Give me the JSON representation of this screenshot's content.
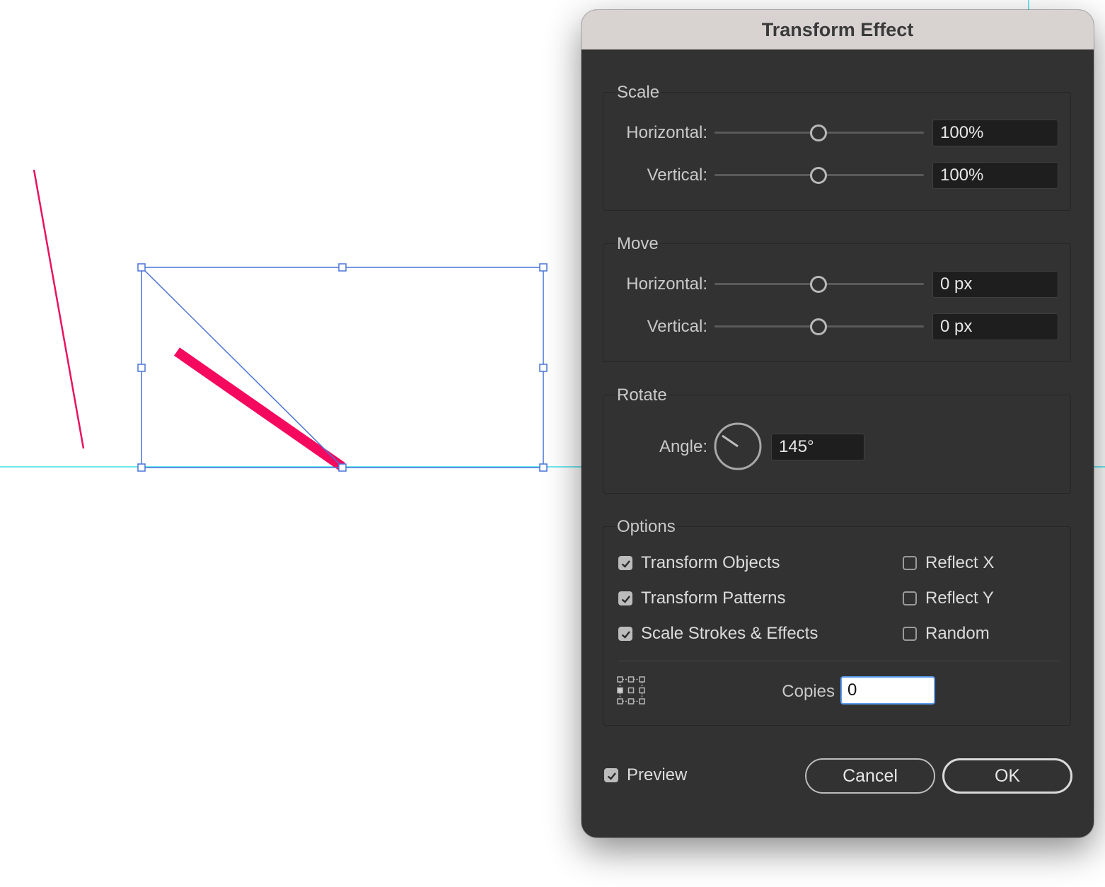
{
  "dialog": {
    "title": "Transform Effect",
    "scale": {
      "title": "Scale",
      "horizontal_label": "Horizontal:",
      "horizontal_value": "100%",
      "vertical_label": "Vertical:",
      "vertical_value": "100%"
    },
    "move": {
      "title": "Move",
      "horizontal_label": "Horizontal:",
      "horizontal_value": "0 px",
      "vertical_label": "Vertical:",
      "vertical_value": "0 px"
    },
    "rotate": {
      "title": "Rotate",
      "angle_label": "Angle:",
      "angle_value": "145°"
    },
    "options": {
      "title": "Options",
      "transform_objects": {
        "label": "Transform Objects",
        "checked": true
      },
      "transform_patterns": {
        "label": "Transform Patterns",
        "checked": true
      },
      "scale_strokes": {
        "label": "Scale Strokes & Effects",
        "checked": true
      },
      "reflect_x": {
        "label": "Reflect X",
        "checked": false
      },
      "reflect_y": {
        "label": "Reflect Y",
        "checked": false
      },
      "random": {
        "label": "Random",
        "checked": false
      },
      "reference_point_icon": "reference-point-grid-icon",
      "copies_label": "Copies",
      "copies_value": "0"
    },
    "preview": {
      "label": "Preview",
      "checked": true
    },
    "buttons": {
      "cancel": "Cancel",
      "ok": "OK"
    }
  },
  "colors": {
    "artwork_stroke": "#e8125e",
    "selection": "#4a74d8",
    "guide": "#3fe0e8",
    "dialog_bg": "#323232",
    "focus_ring": "#5b9bf0"
  }
}
